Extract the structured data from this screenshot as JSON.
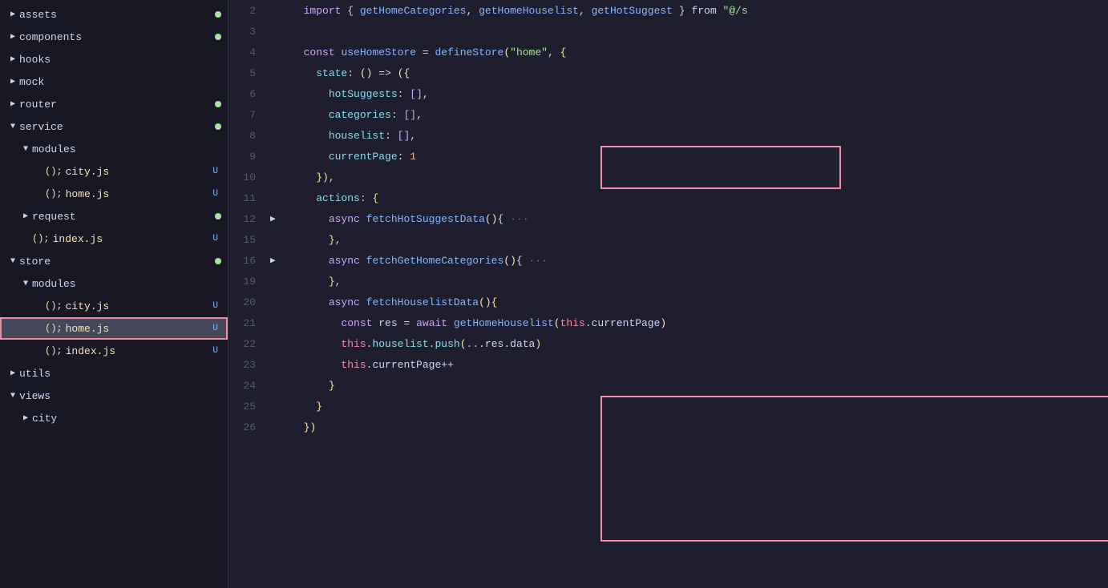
{
  "sidebar": {
    "items": [
      {
        "id": "assets",
        "label": "assets",
        "level": 0,
        "type": "folder",
        "expanded": false,
        "dot": true,
        "badge": null
      },
      {
        "id": "components",
        "label": "components",
        "level": 0,
        "type": "folder",
        "expanded": false,
        "dot": true,
        "badge": null
      },
      {
        "id": "hooks",
        "label": "hooks",
        "level": 0,
        "type": "folder",
        "expanded": false,
        "dot": false,
        "badge": null
      },
      {
        "id": "mock",
        "label": "mock",
        "level": 0,
        "type": "folder",
        "expanded": false,
        "dot": false,
        "badge": null
      },
      {
        "id": "router",
        "label": "router",
        "level": 0,
        "type": "folder",
        "expanded": false,
        "dot": true,
        "badge": null
      },
      {
        "id": "service",
        "label": "service",
        "level": 0,
        "type": "folder",
        "expanded": true,
        "dot": true,
        "badge": null
      },
      {
        "id": "service-modules",
        "label": "modules",
        "level": 1,
        "type": "folder",
        "expanded": true,
        "dot": false,
        "badge": null
      },
      {
        "id": "service-modules-city",
        "label": "city.js",
        "level": 2,
        "type": "file",
        "expanded": false,
        "dot": false,
        "badge": "U"
      },
      {
        "id": "service-modules-home",
        "label": "home.js",
        "level": 2,
        "type": "file",
        "expanded": false,
        "dot": false,
        "badge": "U"
      },
      {
        "id": "service-request",
        "label": "request",
        "level": 1,
        "type": "folder",
        "expanded": false,
        "dot": true,
        "badge": null
      },
      {
        "id": "service-index",
        "label": "index.js",
        "level": 1,
        "type": "file",
        "expanded": false,
        "dot": false,
        "badge": "U"
      },
      {
        "id": "store",
        "label": "store",
        "level": 0,
        "type": "folder",
        "expanded": true,
        "dot": true,
        "badge": null
      },
      {
        "id": "store-modules",
        "label": "modules",
        "level": 1,
        "type": "folder",
        "expanded": true,
        "dot": false,
        "badge": null
      },
      {
        "id": "store-modules-city",
        "label": "city.js",
        "level": 2,
        "type": "file",
        "expanded": false,
        "dot": false,
        "badge": "U"
      },
      {
        "id": "store-modules-home",
        "label": "home.js",
        "level": 2,
        "type": "file",
        "expanded": false,
        "dot": false,
        "badge": "U",
        "selected": true
      },
      {
        "id": "store-index",
        "label": "index.js",
        "level": 2,
        "type": "file",
        "expanded": false,
        "dot": false,
        "badge": "U"
      },
      {
        "id": "utils",
        "label": "utils",
        "level": 0,
        "type": "folder",
        "expanded": false,
        "dot": false,
        "badge": null
      },
      {
        "id": "views",
        "label": "views",
        "level": 0,
        "type": "folder",
        "expanded": true,
        "dot": false,
        "badge": null
      },
      {
        "id": "views-city",
        "label": "city",
        "level": 1,
        "type": "folder",
        "expanded": false,
        "dot": false,
        "badge": null
      }
    ]
  },
  "editor": {
    "lines": [
      {
        "num": 2,
        "arrow": "",
        "content": "import_line_2"
      },
      {
        "num": 3,
        "arrow": "",
        "content": "empty"
      },
      {
        "num": 4,
        "arrow": "",
        "content": "const_line_4"
      },
      {
        "num": 5,
        "arrow": "",
        "content": "state_line_5"
      },
      {
        "num": 6,
        "arrow": "",
        "content": "hotsuggests_line_6"
      },
      {
        "num": 7,
        "arrow": "",
        "content": "categories_line_7"
      },
      {
        "num": 8,
        "arrow": "",
        "content": "houselist_line_8"
      },
      {
        "num": 9,
        "arrow": "",
        "content": "currentpage_line_9"
      },
      {
        "num": 10,
        "arrow": "",
        "content": "close_line_10"
      },
      {
        "num": 11,
        "arrow": "",
        "content": "actions_line_11"
      },
      {
        "num": 12,
        "arrow": "▶",
        "content": "fetchhotsuggests_line_12"
      },
      {
        "num": 15,
        "arrow": "",
        "content": "close_brace_15"
      },
      {
        "num": 16,
        "arrow": "▶",
        "content": "fetchgethomecategories_line_16"
      },
      {
        "num": 19,
        "arrow": "",
        "content": "close_brace_19"
      },
      {
        "num": 20,
        "arrow": "",
        "content": "fetchhouselist_line_20"
      },
      {
        "num": 21,
        "arrow": "",
        "content": "const_res_line_21"
      },
      {
        "num": 22,
        "arrow": "",
        "content": "push_line_22"
      },
      {
        "num": 23,
        "arrow": "",
        "content": "currentpage_inc_line_23"
      },
      {
        "num": 24,
        "arrow": "",
        "content": "close_24"
      },
      {
        "num": 25,
        "arrow": "",
        "content": "close_25"
      },
      {
        "num": 26,
        "arrow": "",
        "content": "close_26"
      }
    ]
  }
}
